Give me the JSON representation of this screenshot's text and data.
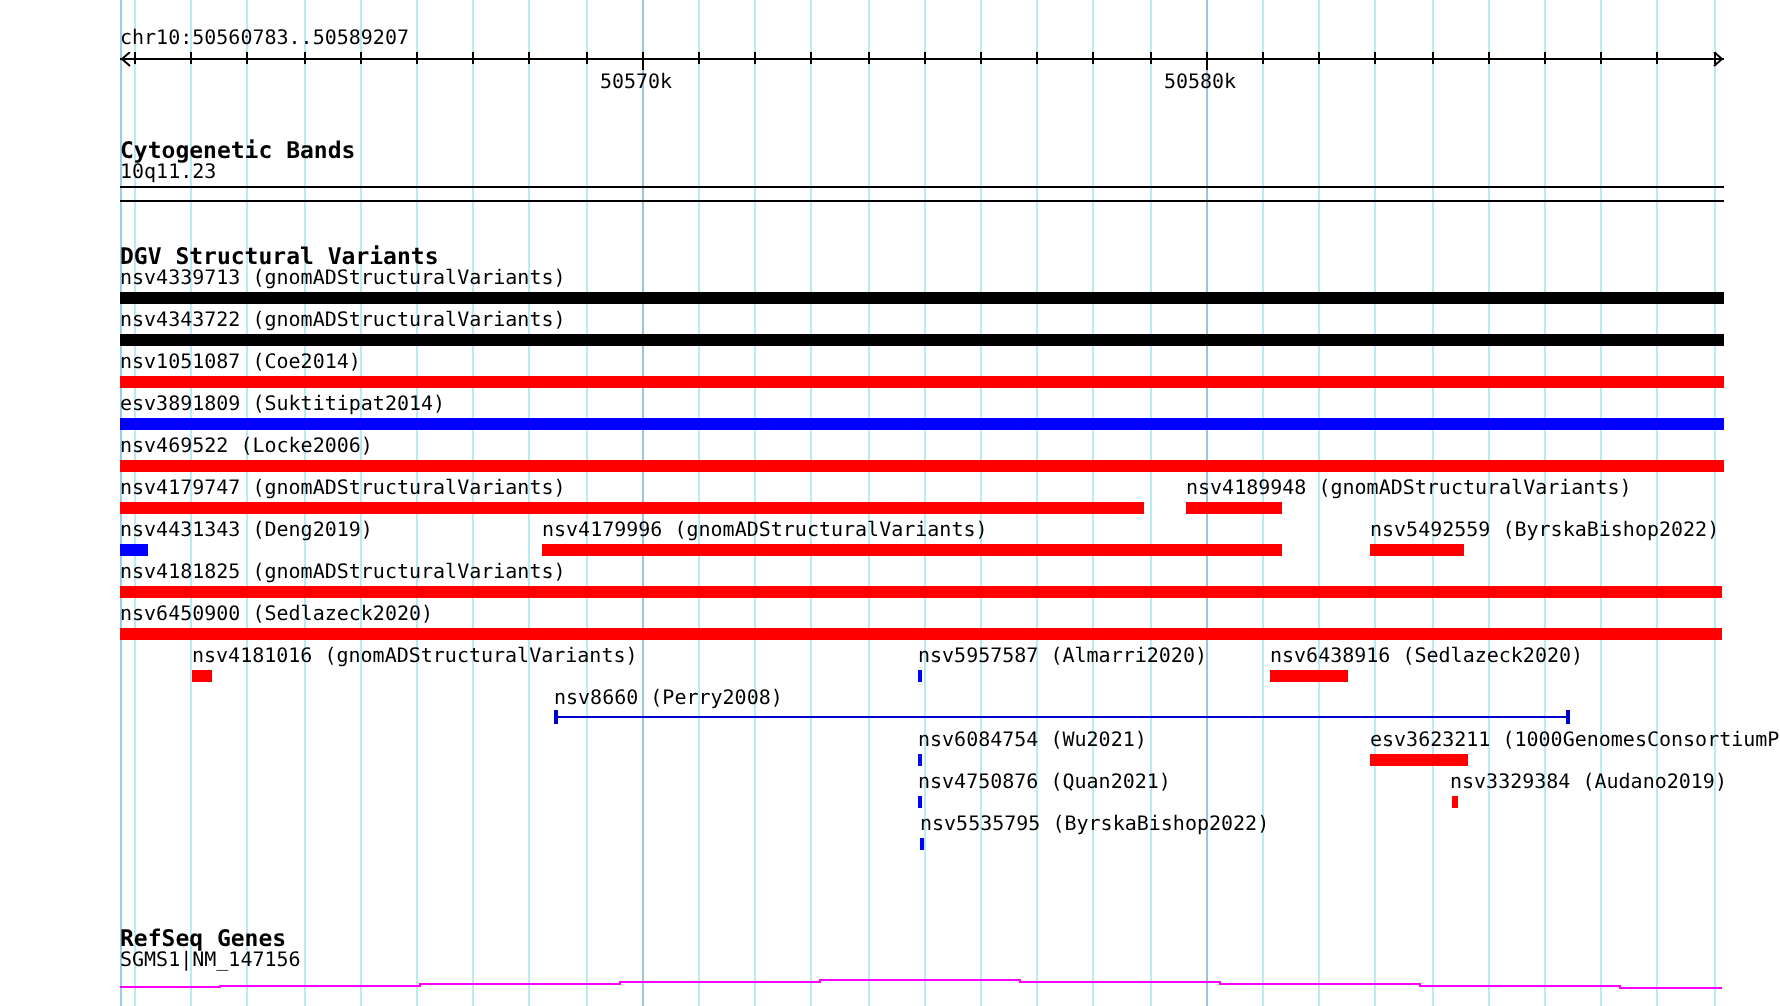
{
  "location": "chr10:50560783..50589207",
  "axis": {
    "ticks": [
      "50570k",
      "50580k"
    ]
  },
  "tracks": [
    {
      "kind": "bands",
      "title": "Cytogenetic Bands",
      "items": [
        {
          "label": "10q11.23"
        }
      ]
    },
    {
      "kind": "variants",
      "title": "DGV Structural Variants",
      "rows": [
        [
          {
            "kind": "block",
            "label": "nsv4339713 (gnomADStructuralVariants)",
            "color": "#000000"
          }
        ],
        [
          {
            "kind": "block",
            "label": "nsv4343722 (gnomADStructuralVariants)",
            "color": "#000000"
          }
        ],
        [
          {
            "kind": "block",
            "label": "nsv1051087 (Coe2014)",
            "color": "#ff0000"
          }
        ],
        [
          {
            "kind": "block",
            "label": "esv3891809 (Suktitipat2014)",
            "color": "#0000ff"
          }
        ],
        [
          {
            "kind": "block",
            "label": "nsv469522 (Locke2006)",
            "color": "#ff0000"
          }
        ],
        [
          {
            "kind": "block",
            "label": "nsv4179747 (gnomADStructuralVariants)",
            "color": "#ff0000"
          },
          {
            "kind": "block",
            "label": "nsv4189948 (gnomADStructuralVariants)",
            "color": "#ff0000"
          }
        ],
        [
          {
            "kind": "block",
            "label": "nsv4431343 (Deng2019)",
            "color": "#0000ff"
          },
          {
            "kind": "block",
            "label": "nsv4179996 (gnomADStructuralVariants)",
            "color": "#ff0000"
          },
          {
            "kind": "block",
            "label": "nsv5492559 (ByrskaBishop2022)",
            "color": "#ff0000"
          }
        ],
        [
          {
            "kind": "block",
            "label": "nsv4181825 (gnomADStructuralVariants)",
            "color": "#ff0000"
          }
        ],
        [
          {
            "kind": "block",
            "label": "nsv6450900 (Sedlazeck2020)",
            "color": "#ff0000"
          }
        ],
        [
          {
            "kind": "block",
            "label": "nsv4181016 (gnomADStructuralVariants)",
            "color": "#ff0000"
          },
          {
            "kind": "block",
            "label": "nsv5957587 (Almarri2020)",
            "color": "#0000ff"
          },
          {
            "kind": "block",
            "label": "nsv6438916 (Sedlazeck2020)",
            "color": "#ff0000"
          }
        ],
        [
          {
            "kind": "span",
            "label": "nsv8660 (Perry2008)",
            "color": "#0000cc"
          }
        ],
        [
          {
            "kind": "block",
            "label": "nsv6084754 (Wu2021)",
            "color": "#0000ff"
          },
          {
            "kind": "block",
            "label": "esv3623211 (1000GenomesConsortiumP",
            "color": "#ff0000"
          }
        ],
        [
          {
            "kind": "block",
            "label": "nsv4750876 (Quan2021)",
            "color": "#0000ff"
          },
          {
            "kind": "block",
            "label": "nsv3329384 (Audano2019)",
            "color": "#ff0000"
          }
        ],
        [
          {
            "kind": "block",
            "label": "nsv5535795 (ByrskaBishop2022)",
            "color": "#0000ff"
          }
        ]
      ]
    },
    {
      "kind": "genes",
      "title": "RefSeq Genes",
      "items": [
        {
          "label": "SGMS1|NM_147156"
        }
      ]
    }
  ]
}
